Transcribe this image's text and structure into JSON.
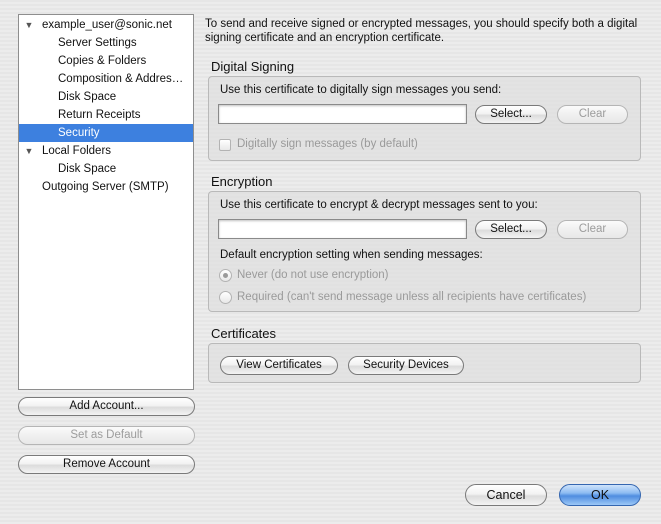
{
  "sidebar": {
    "items": [
      {
        "label": "example_user@sonic.net",
        "expanded": true
      },
      {
        "label": "Server Settings"
      },
      {
        "label": "Copies & Folders"
      },
      {
        "label": "Composition & Addres…"
      },
      {
        "label": "Disk Space"
      },
      {
        "label": "Return Receipts"
      },
      {
        "label": "Security",
        "selected": true
      },
      {
        "label": "Local Folders",
        "expanded": true
      },
      {
        "label": "Disk Space"
      },
      {
        "label": "Outgoing Server (SMTP)"
      }
    ],
    "buttons": {
      "add_account": "Add Account...",
      "set_default": "Set as Default",
      "remove_account": "Remove Account"
    }
  },
  "intro_text": "To send and receive signed or encrypted messages, you should specify both a digital signing certificate and an encryption certificate.",
  "signing": {
    "title": "Digital Signing",
    "cert_label": "Use this certificate to digitally sign messages you send:",
    "cert_value": "",
    "select_label": "Select...",
    "clear_label": "Clear",
    "checkbox_label": "Digitally sign messages (by default)",
    "checkbox_checked": false
  },
  "encryption": {
    "title": "Encryption",
    "cert_label": "Use this certificate to encrypt & decrypt messages sent to you:",
    "cert_value": "",
    "select_label": "Select...",
    "clear_label": "Clear",
    "default_label": "Default encryption setting when sending messages:",
    "options": [
      {
        "label": "Never (do not use encryption)",
        "selected": true
      },
      {
        "label": "Required (can't send message unless all recipients have certificates)",
        "selected": false
      }
    ]
  },
  "certificates": {
    "title": "Certificates",
    "view_label": "View Certificates",
    "devices_label": "Security Devices"
  },
  "footer": {
    "cancel_label": "Cancel",
    "ok_label": "OK"
  },
  "colors": {
    "selection": "#3d80df",
    "default_button": "#4f8de0"
  }
}
